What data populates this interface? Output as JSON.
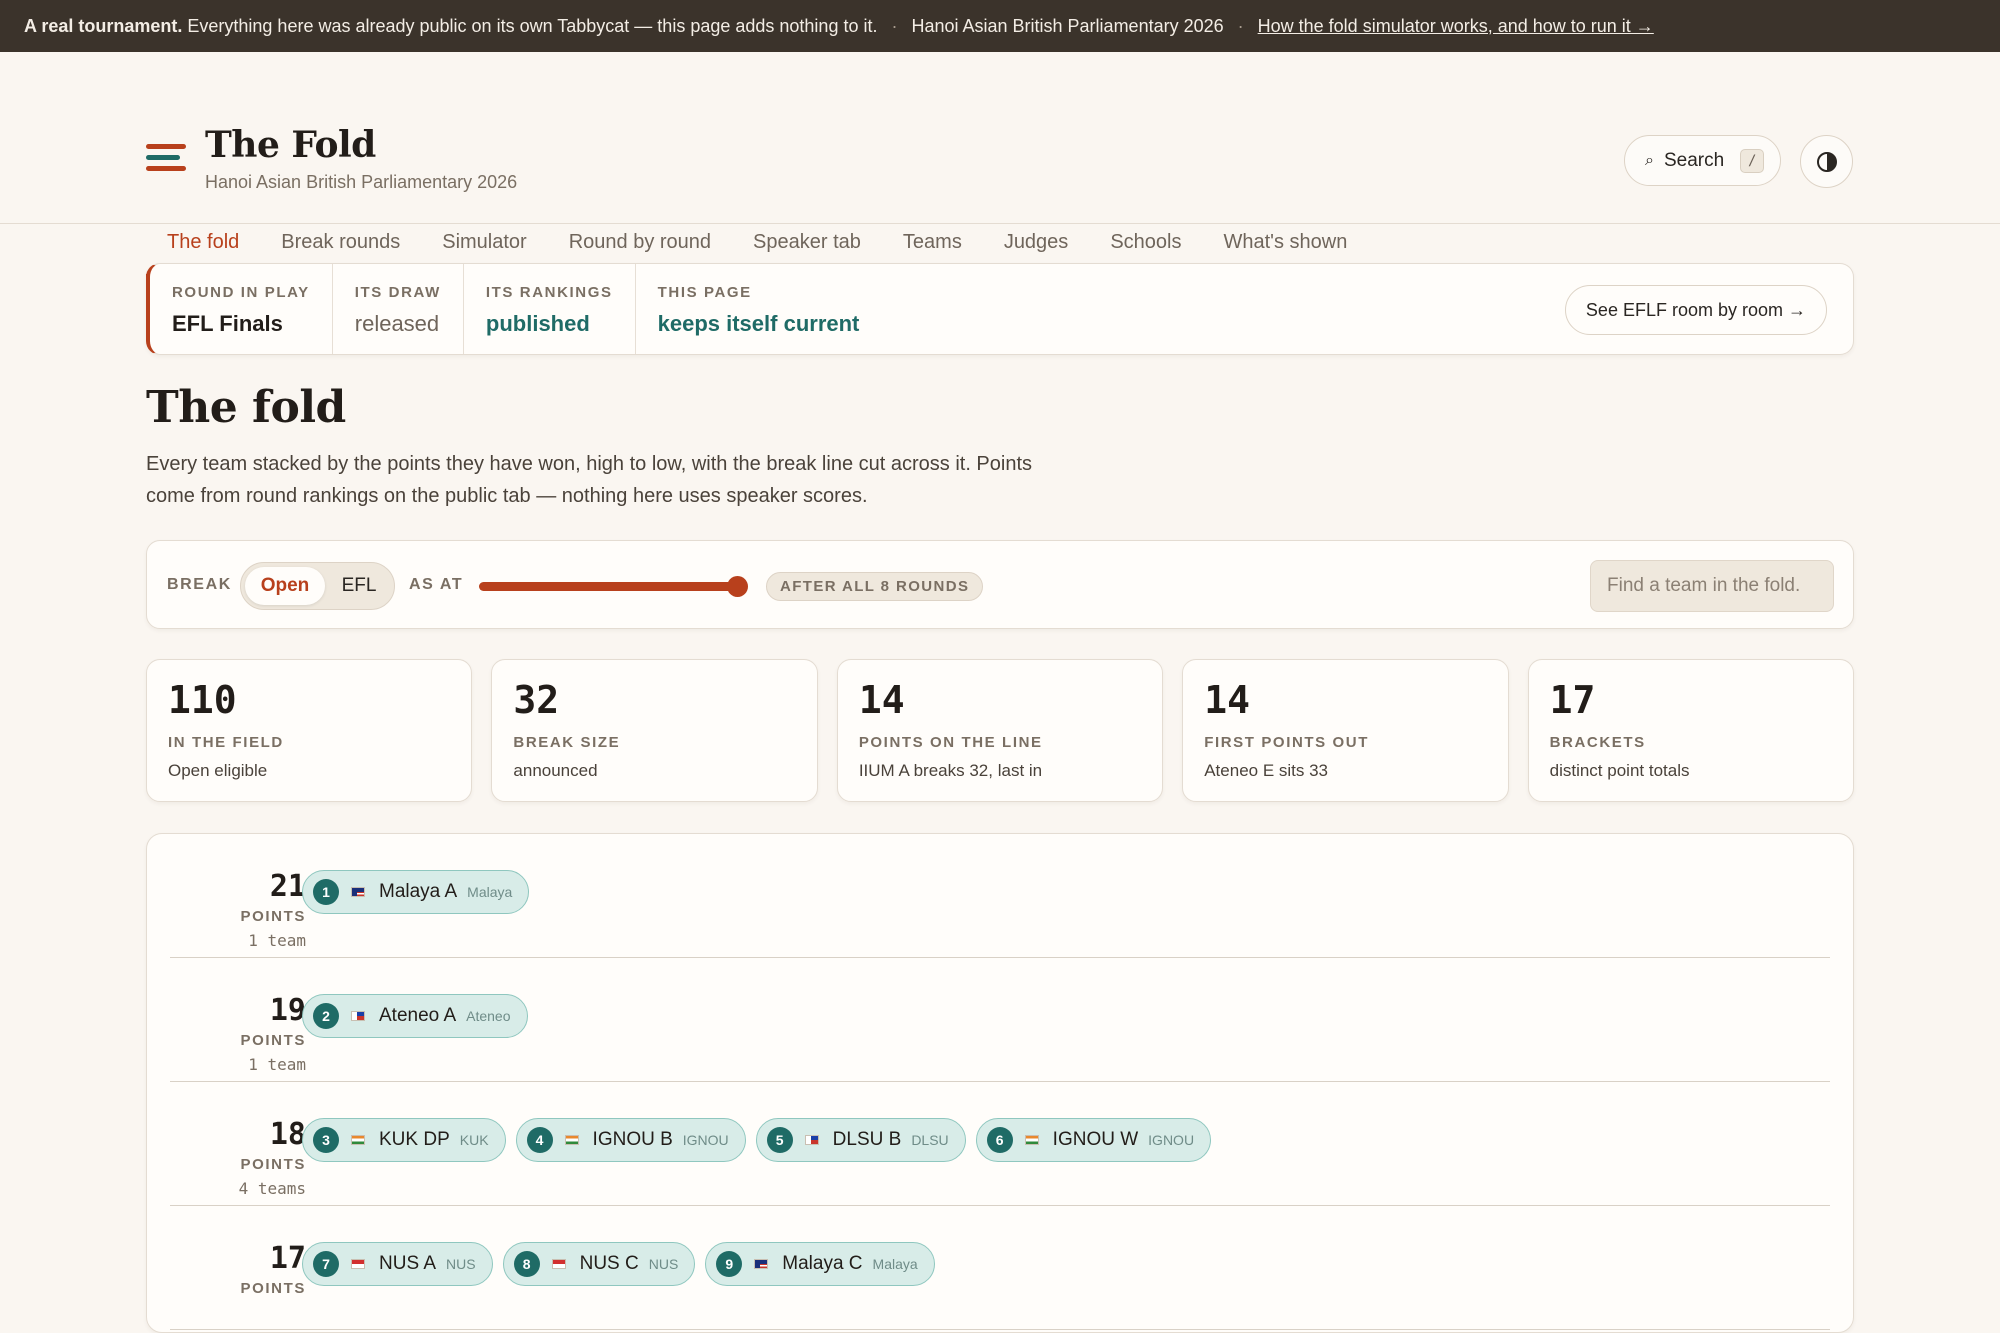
{
  "banner": {
    "lead": "A real tournament.",
    "text": "Everything here was already public on its own Tabbycat — this page adds nothing to it.",
    "sep1": "·",
    "tournament": "Hanoi Asian British Parliamentary 2026",
    "sep2": "·",
    "link": "How the fold simulator works, and how to run it →"
  },
  "header": {
    "title": "The Fold",
    "subtitle": "Hanoi Asian British Parliamentary 2026",
    "search_label": "Search",
    "search_kbd": "/",
    "search_icon": "⌕"
  },
  "tabs": [
    "The fold",
    "Break rounds",
    "Simulator",
    "Round by round",
    "Speaker tab",
    "Teams",
    "Judges",
    "Schools",
    "What's shown"
  ],
  "status": {
    "round_label": "ROUND IN PLAY",
    "round_value": "EFL Finals",
    "draw_label": "ITS DRAW",
    "draw_value": "released",
    "rankings_label": "ITS RANKINGS",
    "rankings_value": "published",
    "page_label": "THIS PAGE",
    "page_value": "keeps itself current",
    "action": "See EFLF room by room →"
  },
  "main": {
    "title": "The fold",
    "intro": "Every team stacked by the points they have won, high to low, with the break line cut across it. Points come from round rankings on the public tab — nothing here uses speaker scores."
  },
  "controls": {
    "break_label": "BREAK",
    "break_options": [
      "Open",
      "EFL"
    ],
    "break_selected": "Open",
    "asat_label": "AS AT",
    "rounds_completed": 8,
    "rounds_total": 8,
    "asat_value": "AFTER ALL 8 ROUNDS",
    "find_placeholder": "Find a team in the fold."
  },
  "stats": [
    {
      "value": "110",
      "label": "IN THE FIELD",
      "sub": "Open eligible"
    },
    {
      "value": "32",
      "label": "BREAK SIZE",
      "sub": "announced"
    },
    {
      "value": "14",
      "label": "POINTS ON THE LINE",
      "sub": "IIUM A breaks 32, last in"
    },
    {
      "value": "14",
      "label": "FIRST POINTS OUT",
      "sub": "Ateneo E sits 33"
    },
    {
      "value": "17",
      "label": "BRACKETS",
      "sub": "distinct point totals"
    }
  ],
  "brackets": [
    {
      "points": "21",
      "label": "POINTS",
      "count": "1 team",
      "teams": [
        {
          "rank": "1",
          "name": "Malaya A",
          "school": "Malaya",
          "flag": "my"
        }
      ]
    },
    {
      "points": "19",
      "label": "POINTS",
      "count": "1 team",
      "teams": [
        {
          "rank": "2",
          "name": "Ateneo A",
          "school": "Ateneo",
          "flag": "ph"
        }
      ]
    },
    {
      "points": "18",
      "label": "POINTS",
      "count": "4 teams",
      "teams": [
        {
          "rank": "3",
          "name": "KUK DP",
          "school": "KUK",
          "flag": "in"
        },
        {
          "rank": "4",
          "name": "IGNOU B",
          "school": "IGNOU",
          "flag": "in"
        },
        {
          "rank": "5",
          "name": "DLSU B",
          "school": "DLSU",
          "flag": "ph"
        },
        {
          "rank": "6",
          "name": "IGNOU W",
          "school": "IGNOU",
          "flag": "in"
        }
      ]
    },
    {
      "points": "17",
      "label": "POINTS",
      "count": "",
      "teams": [
        {
          "rank": "7",
          "name": "NUS A",
          "school": "NUS",
          "flag": "sg"
        },
        {
          "rank": "8",
          "name": "NUS C",
          "school": "NUS",
          "flag": "sg"
        },
        {
          "rank": "9",
          "name": "Malaya C",
          "school": "Malaya",
          "flag": "my"
        }
      ]
    }
  ]
}
